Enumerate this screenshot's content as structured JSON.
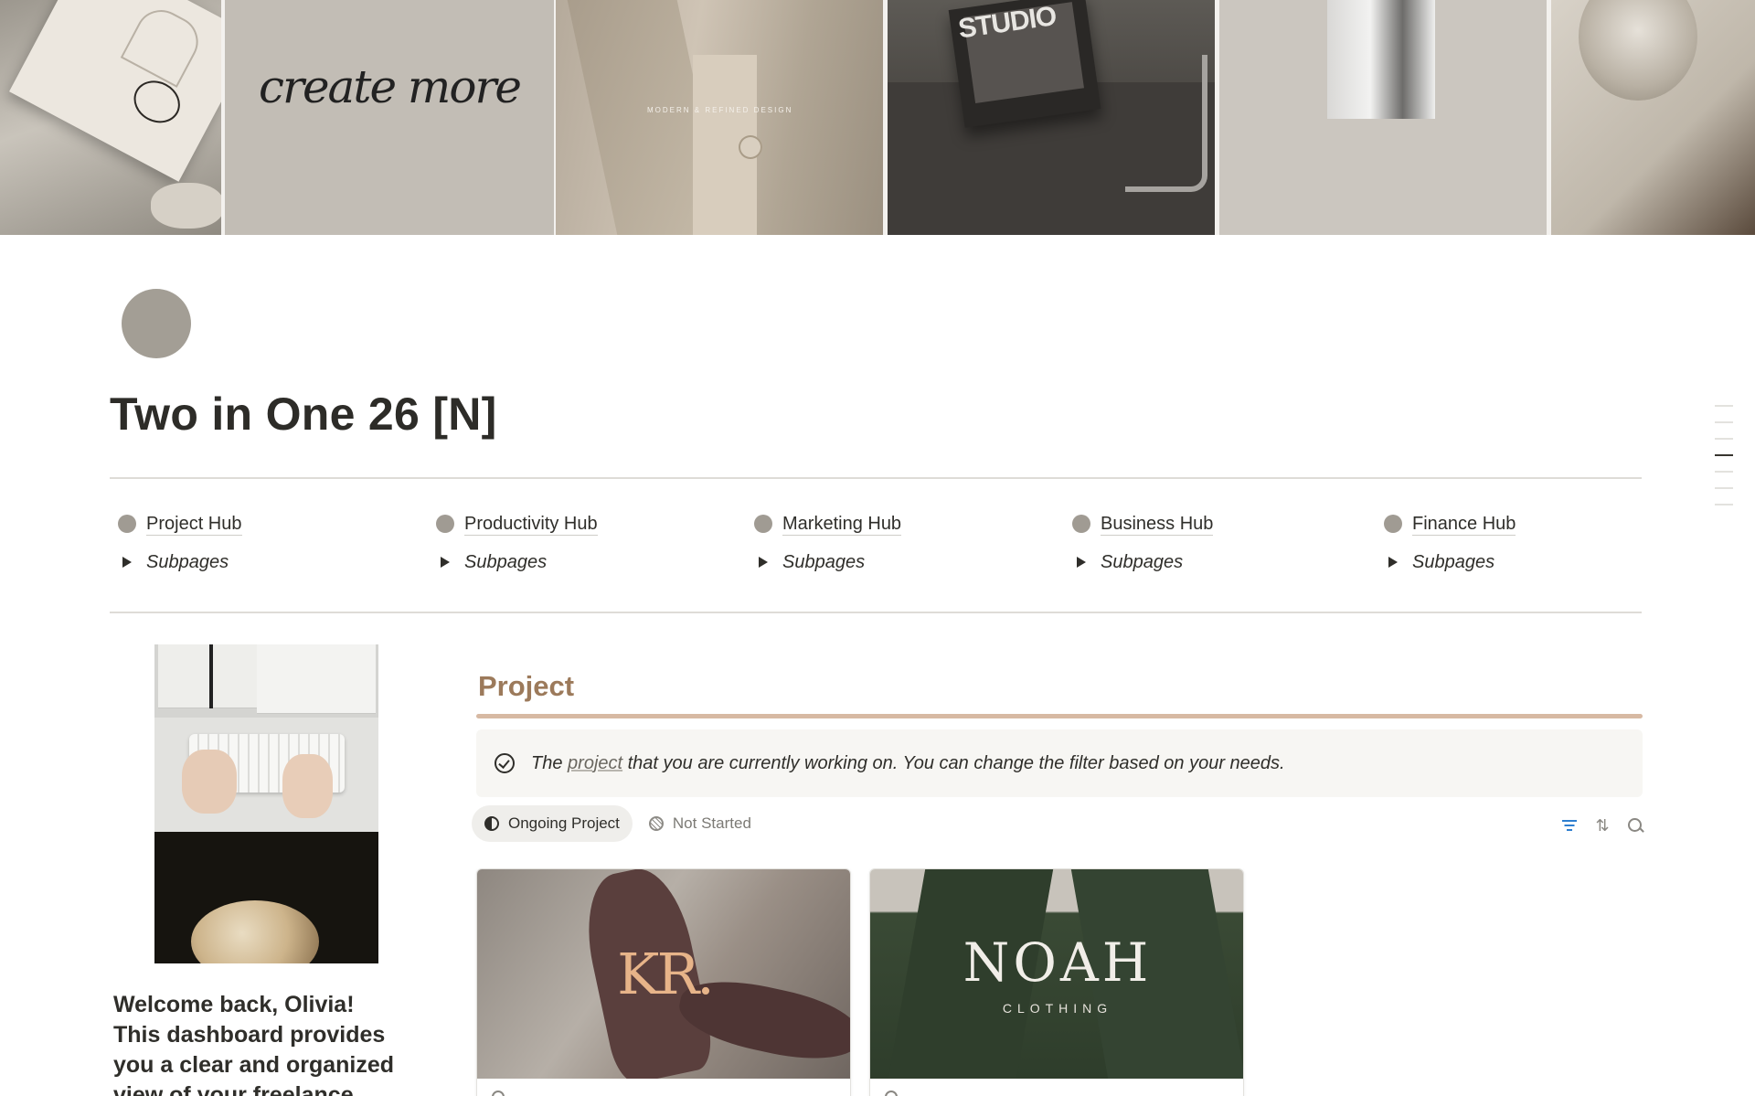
{
  "cover": {
    "tiles": [
      {
        "name": "branding-card"
      },
      {
        "name": "create-more",
        "text": "create more"
      },
      {
        "name": "beige-blazer",
        "text": "MODERN    &    REFINED    DESIGN"
      },
      {
        "name": "studio-magazine",
        "text": "STUDIO"
      },
      {
        "name": "fabric-photo"
      },
      {
        "name": "glass"
      }
    ]
  },
  "page": {
    "icon": "circle-icon",
    "title": "Two in One 26 [N]"
  },
  "hubs": [
    {
      "label": "Project Hub",
      "toggle": "Subpages"
    },
    {
      "label": "Productivity Hub",
      "toggle": "Subpages"
    },
    {
      "label": "Marketing Hub",
      "toggle": "Subpages"
    },
    {
      "label": "Business Hub",
      "toggle": "Subpages"
    },
    {
      "label": "Finance Hub",
      "toggle": "Subpages"
    }
  ],
  "welcome": {
    "text": "Welcome back, Olivia! This dashboard provides you a clear and organized view of your freelance"
  },
  "project": {
    "heading": "Project",
    "callout": {
      "icon": "check-circle-icon",
      "prefix": "The ",
      "link": "project",
      "suffix": " that you are currently working on. You can change the filter based on your needs."
    },
    "tabs": [
      {
        "label": "Ongoing Project",
        "icon": "half-circle-icon",
        "active": true
      },
      {
        "label": "Not Started",
        "icon": "hatched-circle-icon",
        "active": false
      }
    ],
    "actions": {
      "filter_icon": "filter-icon",
      "sort_icon": "sort-icon",
      "sort_glyph": "⇅",
      "search_icon": "search-icon"
    },
    "cards": [
      {
        "logo": "KR.",
        "cover": "fitness-pose"
      },
      {
        "logo": "NOAH",
        "sub": "CLOTHING",
        "cover": "green-coat"
      }
    ]
  },
  "colors": {
    "accent_brown": "#9c7a5b",
    "rule": "#d7b9a3",
    "hub_dot": "#a09b93",
    "filter_blue": "#2e7fd0"
  }
}
